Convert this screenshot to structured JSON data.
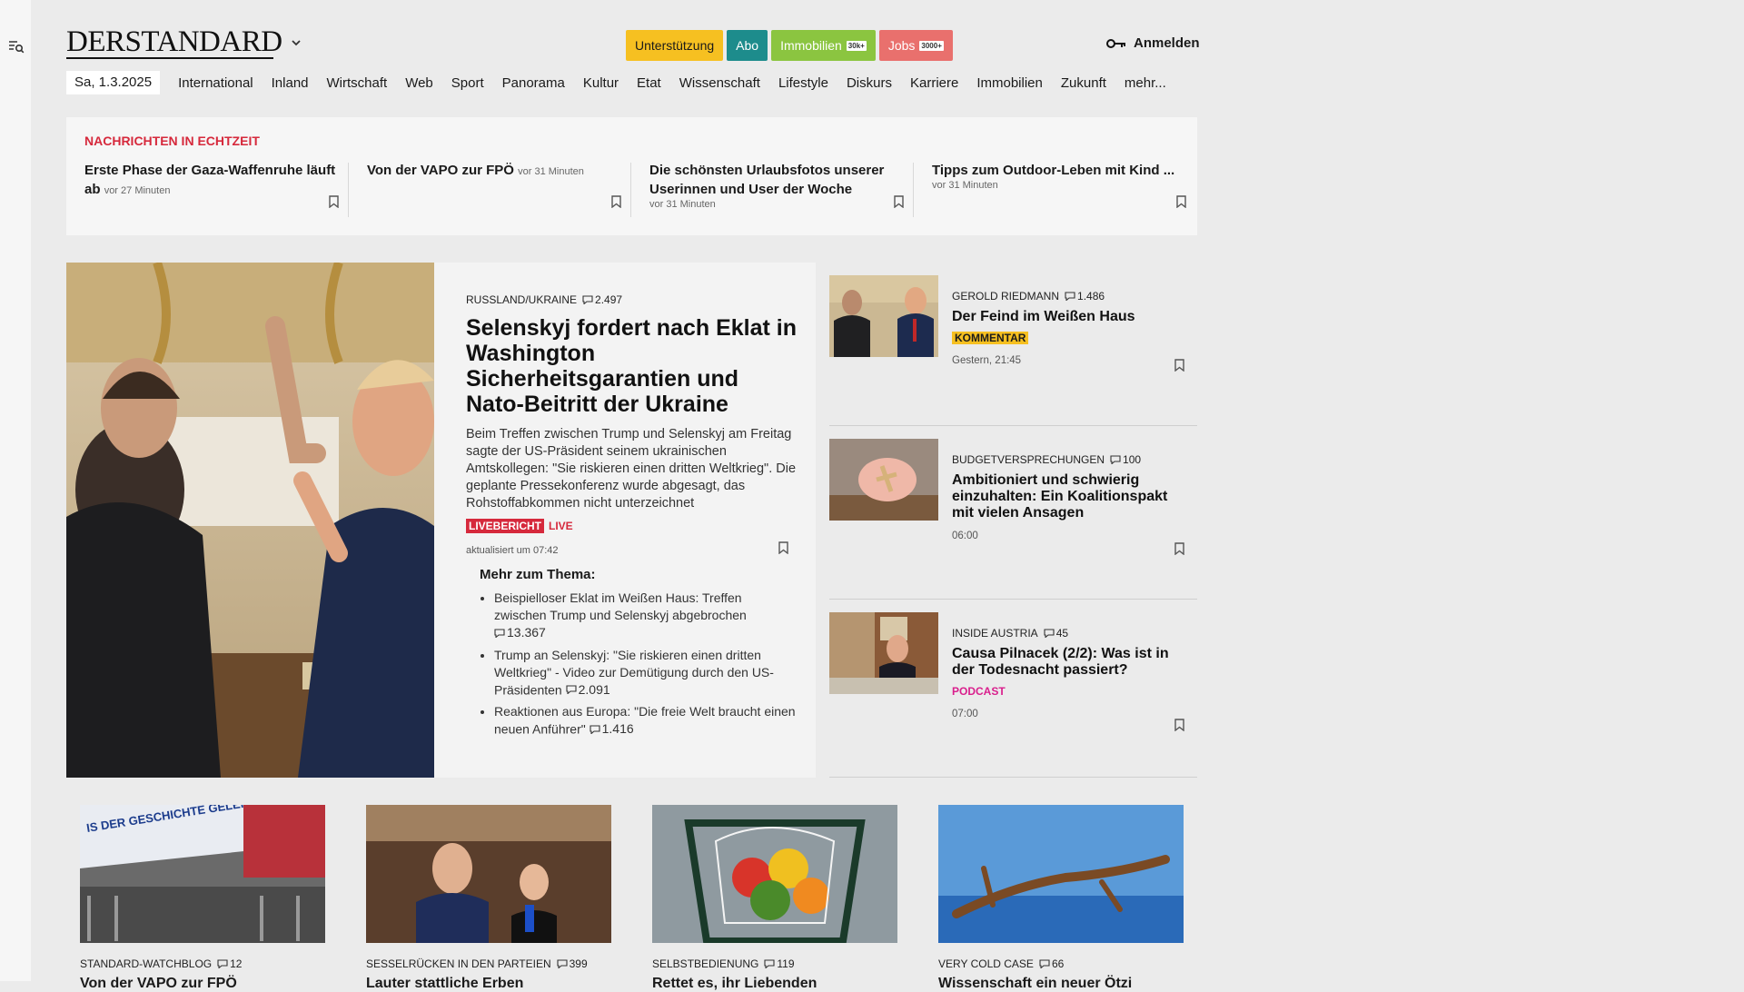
{
  "brand": {
    "logo": "DERSTANDARD"
  },
  "promos": [
    {
      "label": "Unterstützung",
      "badge": ""
    },
    {
      "label": "Abo",
      "badge": ""
    },
    {
      "label": "Immobilien",
      "badge": "30k+"
    },
    {
      "label": "Jobs",
      "badge": "3000+"
    }
  ],
  "login": {
    "label": "Anmelden"
  },
  "nav": {
    "date": "Sa, 1.3.2025",
    "items": [
      "International",
      "Inland",
      "Wirtschaft",
      "Web",
      "Sport",
      "Panorama",
      "Kultur",
      "Etat",
      "Wissenschaft",
      "Lifestyle",
      "Diskurs",
      "Karriere",
      "Immobilien",
      "Zukunft",
      "mehr..."
    ]
  },
  "ticker": {
    "heading": "NACHRICHTEN IN ECHTZEIT",
    "items": [
      {
        "title": "Erste Phase der Gaza-Waffenruhe läuft ab",
        "time": "vor 27 Minuten"
      },
      {
        "title": "Von der VAPO zur FPÖ",
        "time": "vor 31 Minuten"
      },
      {
        "title": "Die schönsten Urlaubsfotos unserer Userinnen und User der Woche",
        "time": "vor 31 Minuten"
      },
      {
        "title": "Tipps zum Outdoor-Leben mit Kind ...",
        "time": "vor 31 Minuten"
      }
    ]
  },
  "hero": {
    "kicker": "RUSSLAND/UKRAINE",
    "comments": "2.497",
    "title": "Selenskyj fordert nach Eklat in Washington Sicherheitsgarantien und Nato-Beitritt der Ukraine",
    "lead": "Beim Treffen zwischen Trump und Selenskyj am Freitag sagte der US-Präsident seinem ukrainischen Amtskollegen: \"Sie riskieren einen dritten Weltkrieg\". Die geplante Pressekonferenz wurde abgesagt, das Rohstoffabkommen nicht unterzeichnet",
    "badge": "LIVEBERICHT",
    "live": "LIVE",
    "updated": "aktualisiert um 07:42",
    "more_heading": "Mehr zum Thema:",
    "more": [
      {
        "text": "Beispielloser Eklat im Weißen Haus: Treffen zwischen Trump und Selenskyj abgebrochen",
        "comments": "13.367"
      },
      {
        "text": "Trump an Selenskyj: \"Sie riskieren einen dritten Weltkrieg\" - Video zur Demütigung durch den US-Präsidenten",
        "comments": "2.091"
      },
      {
        "text": "Reaktionen aus Europa: \"Die freie Welt braucht einen neuen Anführer\"",
        "comments": "1.416"
      }
    ]
  },
  "side": [
    {
      "kicker": "GEROLD RIEDMANN",
      "comments": "1.486",
      "title": "Der Feind im Weißen Haus",
      "tag": "KOMMENTAR",
      "time": "Gestern, 21:45"
    },
    {
      "kicker": "BUDGETVERSPRECHUNGEN",
      "comments": "100",
      "title": "Ambitioniert und schwierig einzuhalten: Ein Koalitionspakt mit vielen Ansagen",
      "tag": "",
      "time": "06:00"
    },
    {
      "kicker": "INSIDE AUSTRIA",
      "comments": "45",
      "title": "Causa Pilnacek (2/2): Was ist in der Todesnacht passiert?",
      "tag": "PODCAST",
      "time": "07:00"
    }
  ],
  "cards": [
    {
      "kicker": "STANDARD-WATCHBLOG",
      "comments": "12",
      "title": "Von der VAPO zur FPÖ"
    },
    {
      "kicker": "SESSELRÜCKEN IN DEN PARTEIEN",
      "comments": "399",
      "title": "Lauter stattliche Erben"
    },
    {
      "kicker": "SELBSTBEDIENUNG",
      "comments": "119",
      "title": "Rettet es, ihr Liebenden"
    },
    {
      "kicker": "VERY COLD CASE",
      "comments": "66",
      "title": "Wissenschaft ein neuer Ötzi"
    }
  ],
  "banner_text": "IS DER GESCHICHTE GELERNT FPÖ HEISST ANTISEMITISMUS UND RASSISMUS",
  "colors": {
    "accent_red": "#d6293c",
    "yellow": "#f6c021",
    "teal": "#1d8c8c",
    "green": "#8bc540",
    "salmon": "#e9706d",
    "podcast": "#d91e8c"
  }
}
